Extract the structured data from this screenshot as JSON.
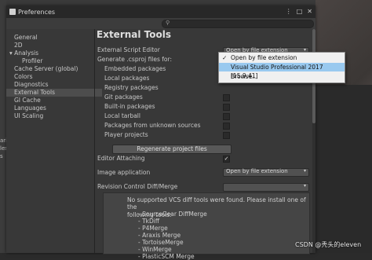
{
  "window": {
    "title": "Preferences",
    "window_buttons": [
      "⋮",
      "□",
      "✕"
    ]
  },
  "search": {
    "icon": "search-icon"
  },
  "sidebar": {
    "items": [
      {
        "label": "General",
        "selected": false
      },
      {
        "label": "2D",
        "selected": false
      },
      {
        "label": "▾ Analysis",
        "selected": false
      },
      {
        "label": "Profiler",
        "selected": false
      },
      {
        "label": "Cache Server (global)",
        "selected": false
      },
      {
        "label": "Colors",
        "selected": false
      },
      {
        "label": "Diagnostics",
        "selected": false
      },
      {
        "label": "External Tools",
        "selected": true
      },
      {
        "label": "GI Cache",
        "selected": false
      },
      {
        "label": "Languages",
        "selected": false
      },
      {
        "label": "UI Scaling",
        "selected": false
      }
    ]
  },
  "content": {
    "heading": "External Tools",
    "script_editor_label": "External Script Editor",
    "script_editor_value": "Open by file extension",
    "csproj_label": "Generate .csproj files for:",
    "csproj_options": [
      {
        "label": "Embedded packages",
        "checked": false
      },
      {
        "label": "Local packages",
        "checked": false
      },
      {
        "label": "Registry packages",
        "checked": false
      },
      {
        "label": "Git packages",
        "checked": false
      },
      {
        "label": "Built-in packages",
        "checked": false
      },
      {
        "label": "Local tarball",
        "checked": false
      },
      {
        "label": "Packages from unknown sources",
        "checked": false
      },
      {
        "label": "Player projects",
        "checked": false
      }
    ],
    "regen_button": "Regenerate project files",
    "editor_attaching_label": "Editor Attaching",
    "editor_attaching_checked": true,
    "image_app_label": "Image application",
    "image_app_value": "Open by file extension",
    "vcs_label": "Revision Control Diff/Merge",
    "vcs_message_line1": "No supported VCS diff tools were found. Please install one of the",
    "vcs_message_line2": "following tools:",
    "vcs_tools": [
      "- SourceGear DiffMerge",
      "- TkDiff",
      "- P4Merge",
      "- Araxis Merge",
      "- TortoiseMerge",
      "- WinMerge",
      "- PlasticSCM Merge"
    ]
  },
  "popup": {
    "options": [
      {
        "label": "Open by file extension",
        "checked": true,
        "highlighted": false
      },
      {
        "label": "Visual Studio Professional 2017 [15.9.41]",
        "checked": false,
        "highlighted": true
      },
      {
        "label": "Browse...",
        "checked": false,
        "highlighted": false
      }
    ]
  },
  "background": {
    "left_edge_text": [
      "aria",
      "les",
      "s"
    ]
  },
  "watermark": "CSDN @秃头的eleven"
}
